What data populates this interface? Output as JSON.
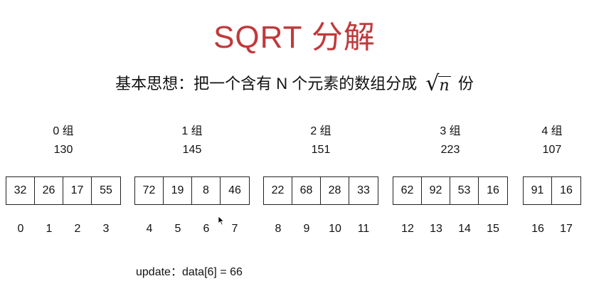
{
  "title": "SQRT 分解",
  "subtitle": {
    "prefix": "基本思想：把一个含有 N 个元素的数组分成",
    "radicand": "n",
    "suffix": "份"
  },
  "groups": [
    {
      "label": "0 组",
      "sum": "130",
      "values": [
        "32",
        "26",
        "17",
        "55"
      ],
      "indices": [
        "0",
        "1",
        "2",
        "3"
      ]
    },
    {
      "label": "1 组",
      "sum": "145",
      "values": [
        "72",
        "19",
        "8",
        "46"
      ],
      "indices": [
        "4",
        "5",
        "6",
        "7"
      ]
    },
    {
      "label": "2 组",
      "sum": "151",
      "values": [
        "22",
        "68",
        "28",
        "33"
      ],
      "indices": [
        "8",
        "9",
        "10",
        "11"
      ]
    },
    {
      "label": "3 组",
      "sum": "223",
      "values": [
        "62",
        "92",
        "53",
        "16"
      ],
      "indices": [
        "12",
        "13",
        "14",
        "15"
      ]
    },
    {
      "label": "4 组",
      "sum": "107",
      "values": [
        "91",
        "16"
      ],
      "indices": [
        "16",
        "17"
      ]
    }
  ],
  "update_text": "update：data[6] = 66",
  "colors": {
    "title": "#c0393b",
    "text": "#111111",
    "border": "#222222"
  }
}
